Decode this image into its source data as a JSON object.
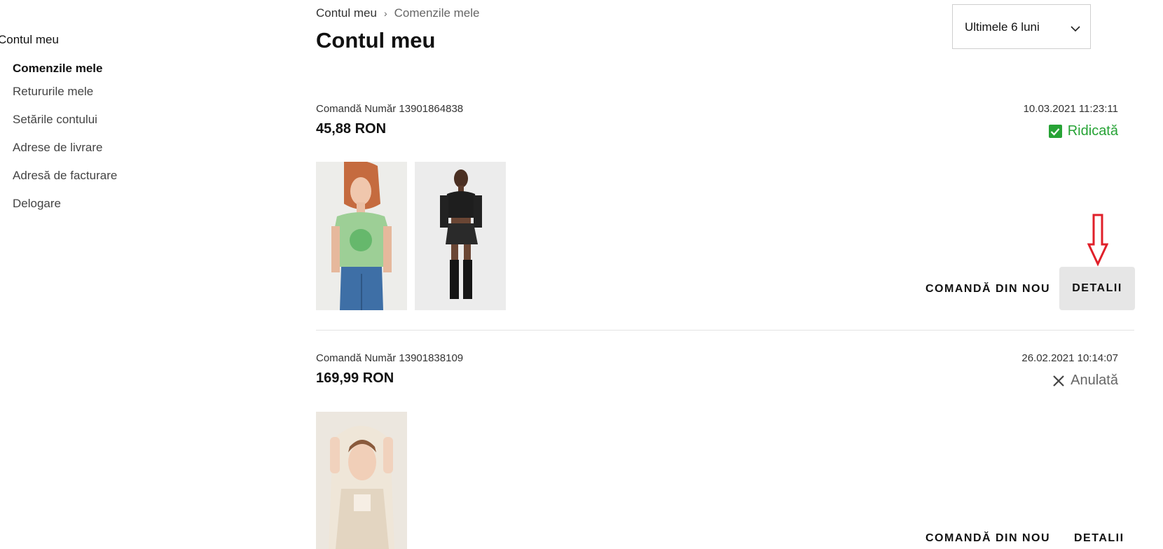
{
  "sidebar": {
    "title": "Contul meu",
    "items": [
      {
        "label": "Comenzile mele",
        "active": true
      },
      {
        "label": "Retururile mele",
        "active": false
      },
      {
        "label": "Setările contului",
        "active": false
      },
      {
        "label": "Adrese de livrare",
        "active": false
      },
      {
        "label": "Adresă de facturare",
        "active": false
      },
      {
        "label": "Delogare",
        "active": false
      }
    ]
  },
  "breadcrumb": {
    "root": "Contul meu",
    "separator": "›",
    "current": "Comenzile mele"
  },
  "page_title": "Contul meu",
  "filter": {
    "selected": "Ultimele 6 luni",
    "icon": "chevron-down-icon"
  },
  "orders": [
    {
      "number_label": "Comandă Număr 13901864838",
      "price": "45,88 RON",
      "date": "10.03.2021 11:23:11",
      "status": "Ridicată",
      "status_icon": "checkbox-check-icon",
      "status_color": "#27a336",
      "products": [
        "green-tshirt-jeans-photo",
        "black-top-shorts-boots-photo"
      ],
      "reorder_label": "COMANDĂ DIN NOU",
      "details_label": "DETALII"
    },
    {
      "number_label": "Comandă Număr 13901838109",
      "price": "169,99 RON",
      "date": "26.02.2021 10:14:07",
      "status": "Anulată",
      "status_icon": "close-icon",
      "status_color": "#666666",
      "products": [
        "cream-hooded-knit-photo"
      ],
      "reorder_label": "COMANDĂ DIN NOU",
      "details_label": "DETALII"
    }
  ],
  "annotation": {
    "icon": "red-down-arrow-icon",
    "color": "#e0202a"
  }
}
